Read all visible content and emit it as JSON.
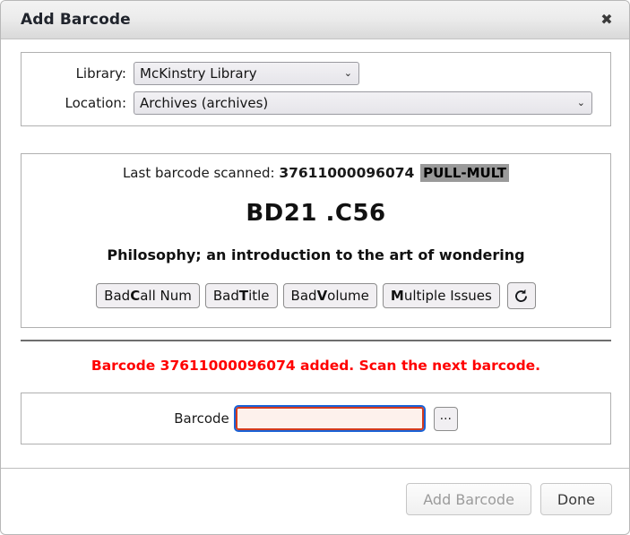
{
  "dialog": {
    "title": "Add Barcode",
    "close_icon": "close-icon",
    "close_glyph": "✖"
  },
  "form": {
    "library": {
      "label": "Library:",
      "value": "McKinstry Library",
      "caret_glyph": "⌄"
    },
    "location": {
      "label": "Location:",
      "value": "Archives (archives)",
      "caret_glyph": "⌄"
    }
  },
  "info": {
    "last_scanned_label": "Last barcode scanned:",
    "last_scanned_barcode": "37611000096074",
    "flag": "PULL-MULT",
    "flag_bg_color": "#9a9a9a",
    "call_number": "BD21 .C56",
    "item_title": "Philosophy; an introduction to the art of wondering",
    "buttons": [
      {
        "name": "bad-call-num-button",
        "pre": "Bad ",
        "accesskey": "C",
        "post": "all Num"
      },
      {
        "name": "bad-title-button",
        "pre": "Bad ",
        "accesskey": "T",
        "post": "itle"
      },
      {
        "name": "bad-volume-button",
        "pre": "Bad ",
        "accesskey": "V",
        "post": "olume"
      },
      {
        "name": "multiple-issues-button",
        "pre": "",
        "accesskey": "M",
        "post": "ultiple Issues"
      }
    ],
    "refresh_icon": "refresh-icon"
  },
  "status": {
    "message": "Barcode 37611000096074 added. Scan the next barcode.",
    "color": "#ff0000"
  },
  "barcode_entry": {
    "label": "Barcode",
    "value": "",
    "placeholder": "",
    "browse_label": "...",
    "focus_ring_color": "#1a62d6",
    "border_color": "#d33a1d",
    "background_color": "#fdf1ec"
  },
  "footer": {
    "add_barcode_label": "Add Barcode",
    "add_barcode_disabled": true,
    "done_label": "Done"
  }
}
